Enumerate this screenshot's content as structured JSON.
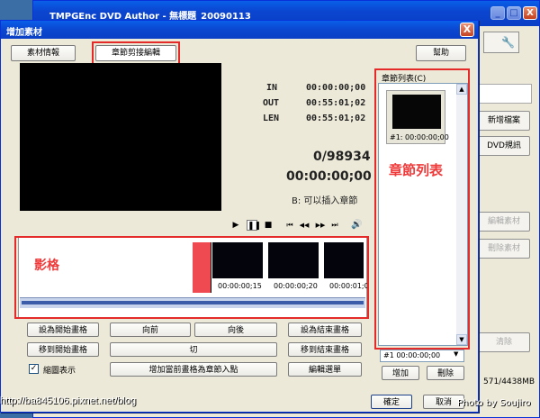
{
  "background_window": {
    "title": "TMPGEnc DVD Author - 無標題_20090113",
    "minimize_label": "_",
    "maximize_label": "□",
    "close_label": "X",
    "buttons": {
      "new_file": "新增檔案",
      "dvd_info": "DVD規訊",
      "edit_material": "編輯素材",
      "delete_material": "刪除素材",
      "clear": "清除"
    },
    "size_readout": "571/4438MB"
  },
  "dialog": {
    "title": "增加素材",
    "close_label": "X",
    "tabs": {
      "material_info": "素材情報",
      "chapter_edit": "章節剪接編輯"
    },
    "help_label": "幫助",
    "timecodes": {
      "in_label": "IN",
      "in_value": "00:00:00;00",
      "out_label": "OUT",
      "out_value": "00:55:01;02",
      "len_label": "LEN",
      "len_value": "00:55:01;02"
    },
    "frame_counter": "0/98934",
    "current_time": "00:00:00;00",
    "hint": "B: 可以插入章節",
    "playback_icons": [
      "play-icon",
      "pause-icon",
      "stop-icon",
      "first-frame-icon",
      "rewind-icon",
      "forward-icon",
      "last-frame-icon",
      "volume-icon"
    ],
    "playback_glyphs": [
      "▶",
      "❚❚",
      "■",
      "⏮",
      "◀◀",
      "▶▶",
      "⏭",
      "🔊"
    ],
    "annotations": {
      "timeline_label": "影格",
      "chapter_list_label": "章節列表"
    },
    "thumbnails": [
      "00:00:00;15",
      "00:00:00;20",
      "00:00:01;0"
    ],
    "buttons": {
      "set_start": "設為開始畫格",
      "prev": "向前",
      "next": "向後",
      "set_end": "設為結束畫格",
      "goto_start": "移到開始畫格",
      "cut": "切",
      "goto_end": "移到結束畫格",
      "zoom_display": "縮圖表示",
      "add_chapter": "增加當前畫格為章節入點",
      "edit_select": "編輯選單",
      "add": "增加",
      "delete": "刪除",
      "ok": "確定",
      "cancel": "取消"
    },
    "chapter_list_header": "章節列表(C)",
    "chapter_items": [
      "#1: 00:00:00;00"
    ],
    "chapter_select_value": "#1   00:00:00;00",
    "zoom_display_checked": "✓"
  },
  "watermark": "http://ba845106.pixnet.net/blog",
  "credit": "Photo by Soujiro",
  "colors": {
    "annotation_red": "#e52a2a",
    "titlebar_blue": "#0b46d0",
    "dialog_bg": "#ece9d8"
  }
}
